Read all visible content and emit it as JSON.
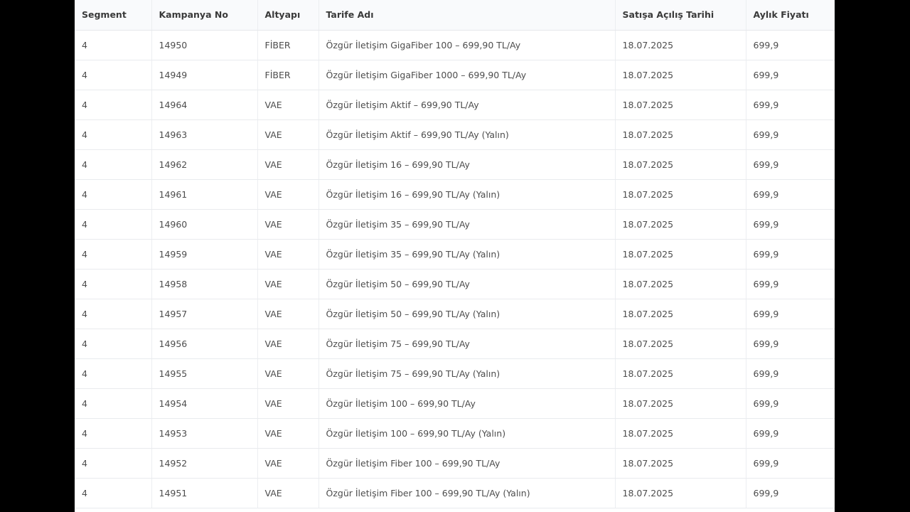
{
  "table": {
    "headers": {
      "segment": "Segment",
      "campaign_no": "Kampanya No",
      "infrastructure": "Altyapı",
      "tariff_name": "Tarife Adı",
      "sale_open_date": "Satışa Açılış Tarihi",
      "monthly_price": "Aylık Fiyatı"
    },
    "rows": [
      {
        "segment": "4",
        "campaign_no": "14950",
        "infrastructure": "FİBER",
        "tariff_name": "Özgür İletişim GigaFiber 100 – 699,90 TL/Ay",
        "sale_open_date": "18.07.2025",
        "monthly_price": "699,9"
      },
      {
        "segment": "4",
        "campaign_no": "14949",
        "infrastructure": "FİBER",
        "tariff_name": "Özgür İletişim GigaFiber 1000 – 699,90 TL/Ay",
        "sale_open_date": "18.07.2025",
        "monthly_price": "699,9"
      },
      {
        "segment": "4",
        "campaign_no": "14964",
        "infrastructure": "VAE",
        "tariff_name": "Özgür İletişim Aktif – 699,90 TL/Ay",
        "sale_open_date": "18.07.2025",
        "monthly_price": "699,9"
      },
      {
        "segment": "4",
        "campaign_no": "14963",
        "infrastructure": "VAE",
        "tariff_name": "Özgür İletişim Aktif – 699,90 TL/Ay (Yalın)",
        "sale_open_date": "18.07.2025",
        "monthly_price": "699,9"
      },
      {
        "segment": "4",
        "campaign_no": "14962",
        "infrastructure": "VAE",
        "tariff_name": "Özgür İletişim 16 – 699,90 TL/Ay",
        "sale_open_date": "18.07.2025",
        "monthly_price": "699,9"
      },
      {
        "segment": "4",
        "campaign_no": "14961",
        "infrastructure": "VAE",
        "tariff_name": "Özgür İletişim 16 – 699,90 TL/Ay (Yalın)",
        "sale_open_date": "18.07.2025",
        "monthly_price": "699,9"
      },
      {
        "segment": "4",
        "campaign_no": "14960",
        "infrastructure": "VAE",
        "tariff_name": "Özgür İletişim 35 – 699,90 TL/Ay",
        "sale_open_date": "18.07.2025",
        "monthly_price": "699,9"
      },
      {
        "segment": "4",
        "campaign_no": "14959",
        "infrastructure": "VAE",
        "tariff_name": "Özgür İletişim 35 – 699,90 TL/Ay (Yalın)",
        "sale_open_date": "18.07.2025",
        "monthly_price": "699,9"
      },
      {
        "segment": "4",
        "campaign_no": "14958",
        "infrastructure": "VAE",
        "tariff_name": "Özgür İletişim 50 – 699,90 TL/Ay",
        "sale_open_date": "18.07.2025",
        "monthly_price": "699,9"
      },
      {
        "segment": "4",
        "campaign_no": "14957",
        "infrastructure": "VAE",
        "tariff_name": "Özgür İletişim 50 – 699,90 TL/Ay (Yalın)",
        "sale_open_date": "18.07.2025",
        "monthly_price": "699,9"
      },
      {
        "segment": "4",
        "campaign_no": "14956",
        "infrastructure": "VAE",
        "tariff_name": "Özgür İletişim 75 – 699,90 TL/Ay",
        "sale_open_date": "18.07.2025",
        "monthly_price": "699,9"
      },
      {
        "segment": "4",
        "campaign_no": "14955",
        "infrastructure": "VAE",
        "tariff_name": "Özgür İletişim 75 – 699,90 TL/Ay (Yalın)",
        "sale_open_date": "18.07.2025",
        "monthly_price": "699,9"
      },
      {
        "segment": "4",
        "campaign_no": "14954",
        "infrastructure": "VAE",
        "tariff_name": "Özgür İletişim 100 – 699,90 TL/Ay",
        "sale_open_date": "18.07.2025",
        "monthly_price": "699,9"
      },
      {
        "segment": "4",
        "campaign_no": "14953",
        "infrastructure": "VAE",
        "tariff_name": "Özgür İletişim 100 – 699,90 TL/Ay (Yalın)",
        "sale_open_date": "18.07.2025",
        "monthly_price": "699,9"
      },
      {
        "segment": "4",
        "campaign_no": "14952",
        "infrastructure": "VAE",
        "tariff_name": "Özgür İletişim Fiber 100 – 699,90 TL/Ay",
        "sale_open_date": "18.07.2025",
        "monthly_price": "699,9"
      },
      {
        "segment": "4",
        "campaign_no": "14951",
        "infrastructure": "VAE",
        "tariff_name": "Özgür İletişim Fiber 100 – 699,90 TL/Ay (Yalın)",
        "sale_open_date": "18.07.2025",
        "monthly_price": "699,9"
      }
    ]
  }
}
